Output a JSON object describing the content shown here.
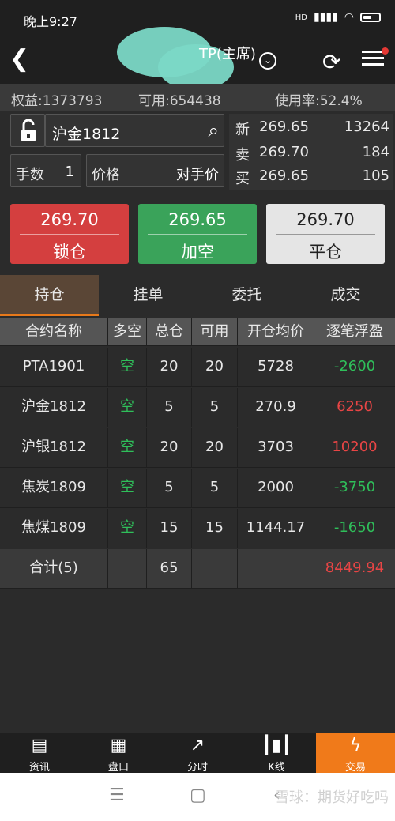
{
  "status_bar": {
    "time": "晚上9:27",
    "network": "HD",
    "signal_icon": "signal-icon",
    "wifi_icon": "wifi-icon",
    "battery_icon": "battery-icon"
  },
  "header": {
    "title": "TP(主席)",
    "back_icon": "back-arrow-icon",
    "dropdown_icon": "chevron-down-icon",
    "refresh_icon": "refresh-icon",
    "menu_icon": "menu-icon"
  },
  "account": {
    "equity": "权益:1373793",
    "available": "可用:654438",
    "usage": "使用率:52.4%"
  },
  "order": {
    "lock_icon": "unlock-icon",
    "contract": "沪金1812",
    "search_icon": "search-icon",
    "qty_label": "手数",
    "qty_value": "1",
    "price_label": "价格",
    "price_value": "对手价"
  },
  "quote": {
    "rows": [
      {
        "name": "新",
        "price": "269.65",
        "volume": "13264"
      },
      {
        "name": "卖",
        "price": "269.70",
        "volume": "184"
      },
      {
        "name": "买",
        "price": "269.65",
        "volume": "105"
      }
    ]
  },
  "actions": [
    {
      "price": "269.70",
      "label": "锁仓",
      "color": "#d43f3f"
    },
    {
      "price": "269.65",
      "label": "加空",
      "color": "#3aa35a"
    },
    {
      "price": "269.70",
      "label": "平仓",
      "color": "#e5e5e5"
    }
  ],
  "tabs": [
    "持仓",
    "挂单",
    "委托",
    "成交"
  ],
  "table": {
    "headers": [
      "合约名称",
      "多空",
      "总仓",
      "可用",
      "开仓均价",
      "逐笔浮盈"
    ],
    "rows": [
      [
        "PTA1901",
        "空",
        "20",
        "20",
        "5728",
        "-2600"
      ],
      [
        "沪金1812",
        "空",
        "5",
        "5",
        "270.9",
        "6250"
      ],
      [
        "沪银1812",
        "空",
        "20",
        "20",
        "3703",
        "10200"
      ],
      [
        "焦炭1809",
        "空",
        "5",
        "5",
        "2000",
        "-3750"
      ],
      [
        "焦煤1809",
        "空",
        "15",
        "15",
        "1144.17",
        "-1650"
      ]
    ],
    "total": [
      "合计(5)",
      "",
      "65",
      "",
      "",
      "8449.94"
    ]
  },
  "nav": [
    {
      "label": "资讯",
      "icon": "news-icon"
    },
    {
      "label": "盘口",
      "icon": "orderbook-icon"
    },
    {
      "label": "分时",
      "icon": "trend-chart-icon"
    },
    {
      "label": "K线",
      "icon": "candlestick-icon"
    },
    {
      "label": "交易",
      "icon": "lightning-icon"
    }
  ],
  "system_nav": {
    "menu": "☰",
    "home": "▢",
    "back": "‹"
  },
  "watermark": "雪球：期货好吃吗"
}
